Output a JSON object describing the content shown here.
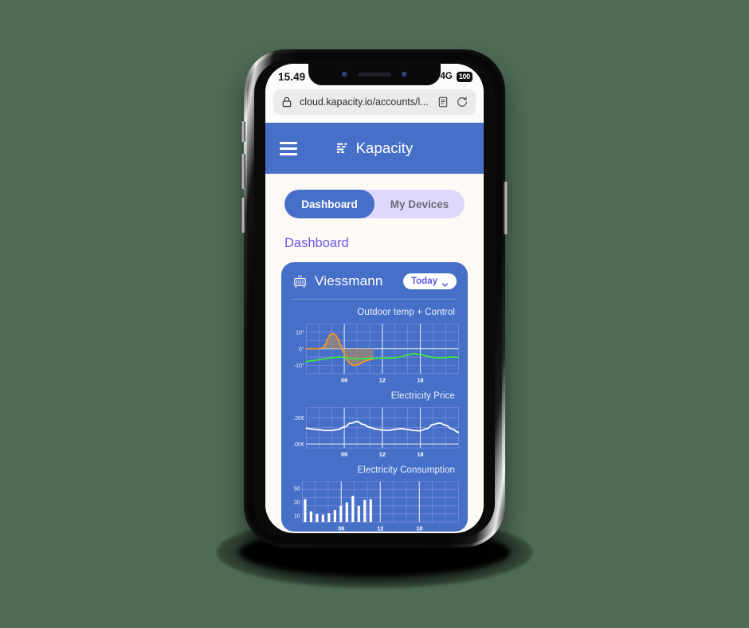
{
  "device": {
    "status_bar": {
      "time": "15.49",
      "network": "4G",
      "battery": "100",
      "signal_icon": "signal-bars-icon",
      "battery_icon": "battery-full-icon"
    },
    "browser": {
      "url": "cloud.kapacity.io/accounts/l...",
      "lock_icon": "lock-icon",
      "reader_icon": "reader-view-icon",
      "reload_icon": "reload-icon"
    }
  },
  "app": {
    "header": {
      "menu_icon": "hamburger-menu-icon",
      "logo_icon": "kapacity-logo-icon",
      "brand": "Kapacity"
    },
    "tabs": [
      {
        "label": "Dashboard",
        "active": true
      },
      {
        "label": "My Devices",
        "active": false
      }
    ],
    "page_title": "Dashboard",
    "card": {
      "icon": "radiator-icon",
      "title": "Viessmann",
      "range_selector": {
        "label": "Today",
        "chevron_icon": "chevron-down-icon"
      }
    },
    "colors": {
      "header_blue": "#4670c8",
      "page_bg": "#fdf9f4",
      "tabs_bg": "#ded9fb",
      "title_purple": "#6d57e8",
      "pill_text": "#5a56e0",
      "grid": "#8f8fe8",
      "control_orange": "#f59a22",
      "outdoor_green": "#3ce83c",
      "price_white": "#ffffff"
    }
  },
  "chart_data": [
    {
      "type": "line",
      "title": "Outdoor temp + Control",
      "xlabel": "",
      "ylabel": "",
      "ylim": [
        -15,
        15
      ],
      "yticks": [
        10,
        0,
        -10
      ],
      "yticklabels": [
        "10°",
        "0°",
        "-10°"
      ],
      "xlim": [
        0,
        24
      ],
      "xticks": [
        6,
        12,
        18
      ],
      "xticklabels": [
        "06",
        "12",
        "18"
      ],
      "grid": true,
      "legend": "none",
      "series": [
        {
          "name": "Control",
          "color": "#f59a22",
          "fill_to_zero": true,
          "x": [
            0,
            1,
            2,
            2.6,
            3,
            3.4,
            3.8,
            4.2,
            4.6,
            5,
            5.4,
            5.8,
            6.2,
            6.6,
            7,
            7.4,
            7.8,
            8.2,
            8.6,
            9,
            9.4,
            9.8,
            10.2,
            10.6
          ],
          "y": [
            0,
            0,
            0,
            0.4,
            2.5,
            6.2,
            8.6,
            9.2,
            8.4,
            6.0,
            2.4,
            -1.5,
            -5.0,
            -7.6,
            -9.2,
            -10.0,
            -10.0,
            -9.5,
            -8.7,
            -7.9,
            -7.3,
            -6.8,
            -6.4,
            -6.1
          ]
        },
        {
          "name": "Outdoor temp",
          "color": "#3ce83c",
          "fill_to_zero": false,
          "x": [
            0,
            1,
            2,
            3,
            4,
            5,
            6,
            7,
            8,
            9,
            10,
            11,
            12,
            13,
            14,
            15,
            16,
            17,
            18,
            19,
            20,
            21,
            22,
            23,
            24
          ],
          "y": [
            -7.6,
            -7.2,
            -6.6,
            -6.0,
            -5.4,
            -5.0,
            -5.2,
            -5.8,
            -6.1,
            -6.0,
            -5.8,
            -5.7,
            -5.6,
            -5.6,
            -5.4,
            -4.8,
            -3.6,
            -3.0,
            -3.4,
            -4.4,
            -5.2,
            -5.5,
            -5.3,
            -5.0,
            -5.2
          ]
        }
      ]
    },
    {
      "type": "line",
      "title": "Electricity Price",
      "xlabel": "",
      "ylabel": "",
      "ylim": [
        -0.03,
        0.28
      ],
      "yticks": [
        0.2,
        0.0
      ],
      "yticklabels": [
        ".20€",
        ".00€"
      ],
      "xlim": [
        0,
        24
      ],
      "xticks": [
        6,
        12,
        18
      ],
      "xticklabels": [
        "06",
        "12",
        "18"
      ],
      "grid": true,
      "legend": "none",
      "series": [
        {
          "name": "Price",
          "color": "#ffffff",
          "fill_to_zero": false,
          "x": [
            0,
            1,
            2,
            3,
            4,
            5,
            6,
            7,
            8,
            9,
            10,
            11,
            12,
            13,
            14,
            15,
            16,
            17,
            18,
            19,
            20,
            21,
            22,
            23,
            24
          ],
          "y": [
            0.121,
            0.115,
            0.11,
            0.104,
            0.104,
            0.112,
            0.13,
            0.16,
            0.172,
            0.15,
            0.128,
            0.115,
            0.107,
            0.106,
            0.113,
            0.118,
            0.112,
            0.104,
            0.102,
            0.118,
            0.15,
            0.161,
            0.145,
            0.115,
            0.09
          ]
        }
      ]
    },
    {
      "type": "bar",
      "title": "Electricity Consumption",
      "xlabel": "",
      "ylabel": "",
      "ylim": [
        0,
        60
      ],
      "yticks": [
        50,
        30,
        10
      ],
      "yticklabels": [
        "50",
        "30",
        "10"
      ],
      "xlim": [
        0,
        24
      ],
      "xticks": [
        6,
        12,
        18
      ],
      "xticklabels": [
        "06",
        "12",
        "18"
      ],
      "grid": true,
      "legend": "none",
      "categories": [
        "0",
        "1",
        "2",
        "3",
        "4",
        "5",
        "6",
        "7",
        "8",
        "9",
        "10",
        "11"
      ],
      "values": [
        34,
        16,
        12,
        11,
        13,
        18,
        24,
        29,
        39,
        24,
        33,
        34
      ],
      "bar_color": "#ffffff"
    }
  ]
}
